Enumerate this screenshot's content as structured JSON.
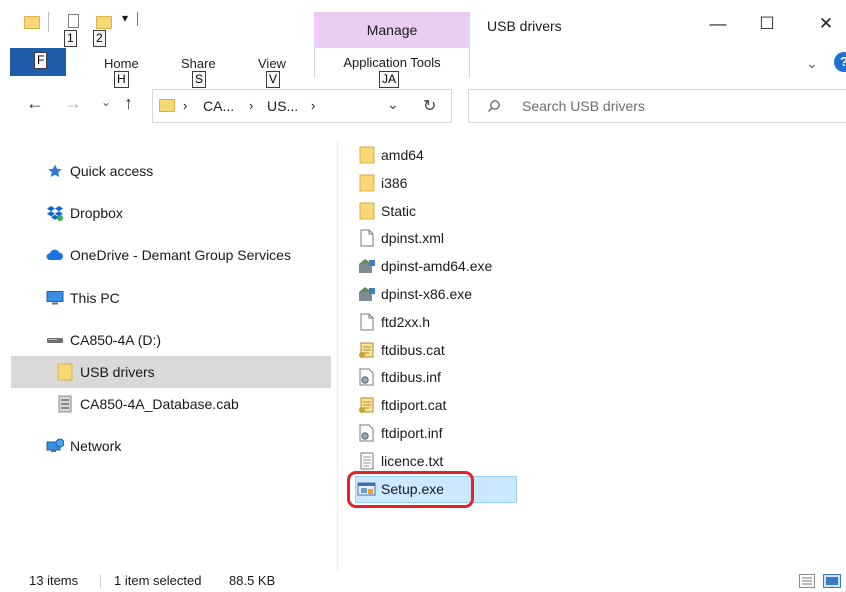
{
  "window": {
    "title": "USB drivers",
    "contextual_tab_group": "Manage",
    "controls": {
      "minimize": "—",
      "maximize": "☐",
      "close": "✕"
    }
  },
  "quick_access_toolbar": {
    "dropdown_glyph": "▾",
    "keytips": [
      "1",
      "2"
    ]
  },
  "ribbon": {
    "file_keytip": "F",
    "tabs": [
      {
        "label": "Home",
        "keytip": "H"
      },
      {
        "label": "Share",
        "keytip": "S"
      },
      {
        "label": "View",
        "keytip": "V"
      },
      {
        "label": "Application Tools",
        "keytip": "JA"
      }
    ],
    "collapse_glyph": "⌄",
    "help_glyph": "?"
  },
  "address_bar": {
    "back": "←",
    "forward": "→",
    "recent": "⌄",
    "up": "↑",
    "breadcrumb": [
      "CA...",
      "US..."
    ],
    "separator": "›",
    "dropdown": "⌄",
    "refresh": "↻"
  },
  "search": {
    "placeholder": "Search USB drivers",
    "icon": "search-icon"
  },
  "nav_pane": {
    "items": [
      {
        "label": "Quick access",
        "icon": "star-icon"
      },
      {
        "label": "Dropbox",
        "icon": "dropbox-icon"
      },
      {
        "label": "OneDrive - Demant Group Services",
        "icon": "cloud-icon"
      },
      {
        "label": "This PC",
        "icon": "monitor-icon"
      },
      {
        "label": "CA850-4A (D:)",
        "icon": "drive-icon"
      },
      {
        "label": "USB drivers",
        "icon": "folder-icon",
        "selected": true
      },
      {
        "label": "CA850-4A_Database.cab",
        "icon": "cab-file-icon"
      },
      {
        "label": "Network",
        "icon": "network-icon"
      }
    ]
  },
  "files": [
    {
      "name": "amd64",
      "icon": "folder-icon"
    },
    {
      "name": "i386",
      "icon": "folder-icon"
    },
    {
      "name": "Static",
      "icon": "folder-icon"
    },
    {
      "name": "dpinst.xml",
      "icon": "document-icon"
    },
    {
      "name": "dpinst-amd64.exe",
      "icon": "installer-icon"
    },
    {
      "name": "dpinst-x86.exe",
      "icon": "installer-icon"
    },
    {
      "name": "ftd2xx.h",
      "icon": "document-icon"
    },
    {
      "name": "ftdibus.cat",
      "icon": "catalog-icon"
    },
    {
      "name": "ftdibus.inf",
      "icon": "setup-info-icon"
    },
    {
      "name": "ftdiport.cat",
      "icon": "catalog-icon"
    },
    {
      "name": "ftdiport.inf",
      "icon": "setup-info-icon"
    },
    {
      "name": "licence.txt",
      "icon": "text-file-icon"
    },
    {
      "name": "Setup.exe",
      "icon": "setup-exe-icon",
      "selected": true,
      "highlighted": true
    }
  ],
  "status_bar": {
    "item_count": "13 items",
    "selection": "1 item selected",
    "size": "88.5 KB"
  },
  "colors": {
    "manage_tab": "#e9cdf2",
    "file_tab": "#1f5dab",
    "selection": "#cce8ff",
    "nav_selection": "#d9d9d9",
    "highlight_outline": "#e3222b",
    "folder": "#f8d775"
  }
}
